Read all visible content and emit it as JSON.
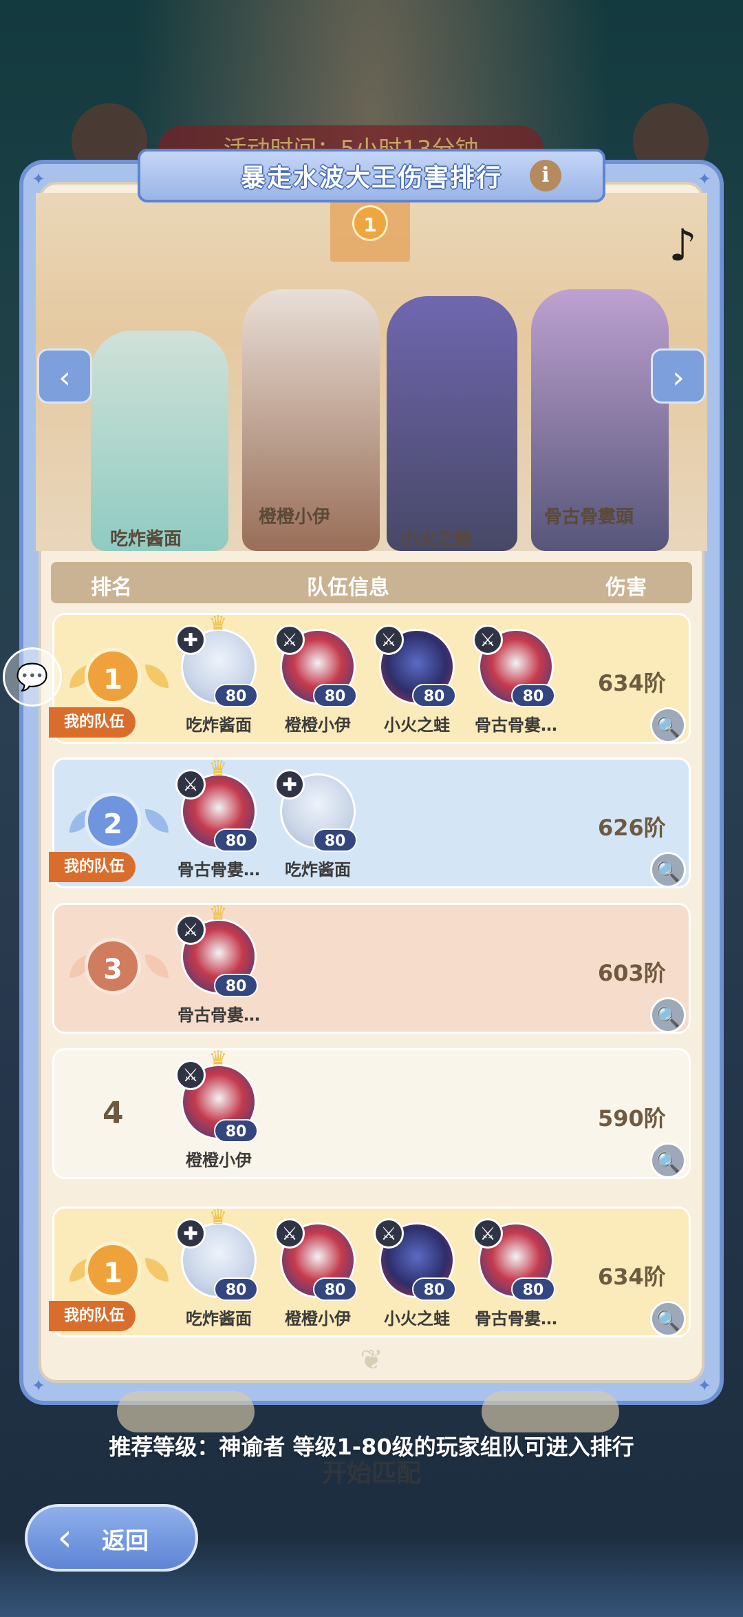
{
  "hud": {
    "event_time": "活动时间：5小时13分钟"
  },
  "panel": {
    "title": "暴走水波大王伤害排行",
    "info_icon": "i"
  },
  "hero": {
    "top_rank": "1",
    "characters": [
      {
        "name": "吃炸酱面"
      },
      {
        "name": "橙橙小伊"
      },
      {
        "name": "小火之蛙"
      },
      {
        "name": "骨古骨婁頭"
      }
    ]
  },
  "nav": {
    "prev_icon": "‹",
    "next_icon": "›"
  },
  "table": {
    "headers": {
      "rank": "排名",
      "team": "队伍信息",
      "damage": "伤害"
    },
    "rows": [
      {
        "rank": "1",
        "my_team": "我的队伍",
        "damage": "634阶",
        "members": [
          {
            "name": "吃炸酱面",
            "level": "80"
          },
          {
            "name": "橙橙小伊",
            "level": "80"
          },
          {
            "name": "小火之蛙",
            "level": "80"
          },
          {
            "name": "骨古骨婁…",
            "level": "80"
          }
        ]
      },
      {
        "rank": "2",
        "my_team": "我的队伍",
        "damage": "626阶",
        "members": [
          {
            "name": "骨古骨婁…",
            "level": "80"
          },
          {
            "name": "吃炸酱面",
            "level": "80"
          }
        ]
      },
      {
        "rank": "3",
        "damage": "603阶",
        "members": [
          {
            "name": "骨古骨婁…",
            "level": "80"
          }
        ]
      },
      {
        "rank": "4",
        "damage": "590阶",
        "members": [
          {
            "name": "橙橙小伊",
            "level": "80"
          }
        ]
      }
    ],
    "my_row": {
      "rank": "1",
      "my_team": "我的队伍",
      "damage": "634阶",
      "members": [
        {
          "name": "吃炸酱面",
          "level": "80"
        },
        {
          "name": "橙橙小伊",
          "level": "80"
        },
        {
          "name": "小火之蛙",
          "level": "80"
        },
        {
          "name": "骨古骨婁…",
          "level": "80"
        }
      ]
    }
  },
  "footer": {
    "recommend": "推荐等级：神谕者 等级1-80级的玩家组队可进入排行",
    "start_match": "开始匹配",
    "back": "返回"
  },
  "colors": {
    "gold_row": "#fbeaba",
    "blue_row": "#d4e6f6",
    "peach_row": "#f6dccb",
    "plain_row": "#faf5ea",
    "accent": "#6f92d6"
  }
}
